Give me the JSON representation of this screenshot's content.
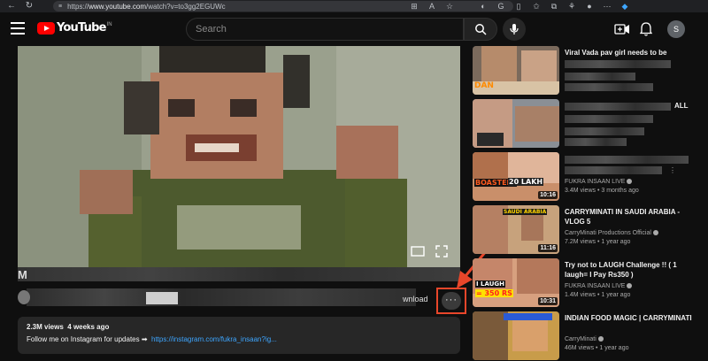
{
  "browser": {
    "url_prefix": "https://",
    "url_host": "www.youtube.com",
    "url_path": "/watch?v=to3gg2EGUWc"
  },
  "header": {
    "logo_text": "YouTube",
    "country_code": "IN",
    "search_placeholder": "Search",
    "avatar_letter": "S"
  },
  "video": {
    "title_visible_fragment": "M",
    "download_label_fragment": "wnload",
    "more_label": "···",
    "views": "2.3M views",
    "age": "4 weeks ago",
    "description_text": "Follow me on Instagram for updates ➡",
    "description_link": "https://instagram.com/fukra_insaan?ig..."
  },
  "recommendations": [
    {
      "title": "Viral Vada pav girl needs to be",
      "channel": "",
      "stats": "",
      "duration": "",
      "thumb_text": "DAN"
    },
    {
      "title": "ALL",
      "channel": "",
      "stats": "",
      "duration": "",
      "thumb_text": ""
    },
    {
      "title": "",
      "channel": "FUKRA INSAAN LIVE",
      "stats": "3.4M views • 3 months ago",
      "duration": "10:16",
      "thumb_text": "BOASTED!",
      "thumb_text2": "20 LAKH"
    },
    {
      "title": "CARRYMINATI IN SAUDI ARABIA - VLOG 5",
      "channel": "CarryMinati Productions Official",
      "stats": "7.2M views • 1 year ago",
      "duration": "11:16",
      "thumb_text": "SAUDI ARABIA"
    },
    {
      "title": "Try not to LAUGH Challenge !! ( 1 laugh= I Pay Rs350 )",
      "channel": "FUKRA INSAAN LIVE",
      "stats": "1.4M views • 1 year ago",
      "duration": "10:31",
      "thumb_text": "I LAUGH",
      "thumb_text2": "= 350 RS"
    },
    {
      "title": "INDIAN FOOD MAGIC | CARRYMINATI",
      "channel": "CarryMinati",
      "stats": "46M views • 1 year ago",
      "duration": "",
      "thumb_text": ""
    }
  ],
  "colors": {
    "highlight": "#e8462a",
    "link": "#3ea6ff",
    "brand_red": "#ff0000"
  }
}
